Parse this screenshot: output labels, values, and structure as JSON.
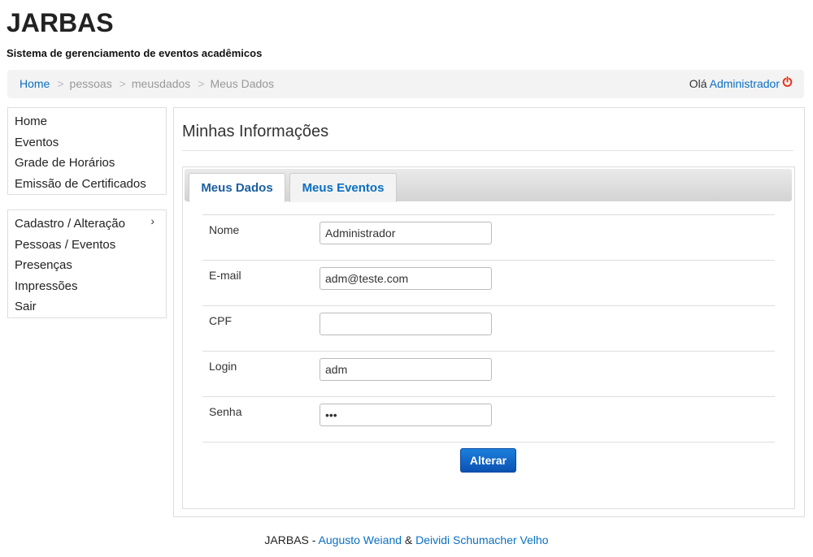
{
  "app": {
    "title": "JARBAS",
    "subtitle": "Sistema de gerenciamento de eventos acadêmicos"
  },
  "breadcrumb": {
    "items": [
      "Home",
      "pessoas",
      "meusdados",
      "Meus Dados"
    ],
    "separator": ">"
  },
  "user": {
    "greeting": "Olá",
    "name": "Administrador",
    "logout_icon": "power-icon",
    "logout_icon_color": "#e8341c"
  },
  "sidebar": {
    "menu1": [
      "Home",
      "Eventos",
      "Grade de Horários",
      "Emissão de Certificados"
    ],
    "menu2": [
      "Cadastro / Alteração",
      "Pessoas / Eventos",
      "Presenças",
      "Impressões",
      "Sair"
    ],
    "submenu_indicator": "›"
  },
  "main": {
    "heading": "Minhas Informações",
    "tabs": [
      "Meus Dados",
      "Meus Eventos"
    ],
    "active_tab": "Meus Dados",
    "form": {
      "fields": [
        {
          "label": "Nome",
          "value": "Administrador"
        },
        {
          "label": "E-mail",
          "value": "adm@teste.com"
        },
        {
          "label": "CPF",
          "value": ""
        },
        {
          "label": "Login",
          "value": "adm"
        },
        {
          "label": "Senha",
          "value": "•••"
        }
      ],
      "submit_label": "Alterar"
    }
  },
  "footer": {
    "prefix": "JARBAS - ",
    "author1": "Augusto Weiand",
    "connector": " & ",
    "author2": "Deividi Schumacher Velho"
  },
  "colors": {
    "link": "#0a6fc2",
    "button": "#0b52b2",
    "breadcrumb_bg": "#f3f3f3"
  }
}
